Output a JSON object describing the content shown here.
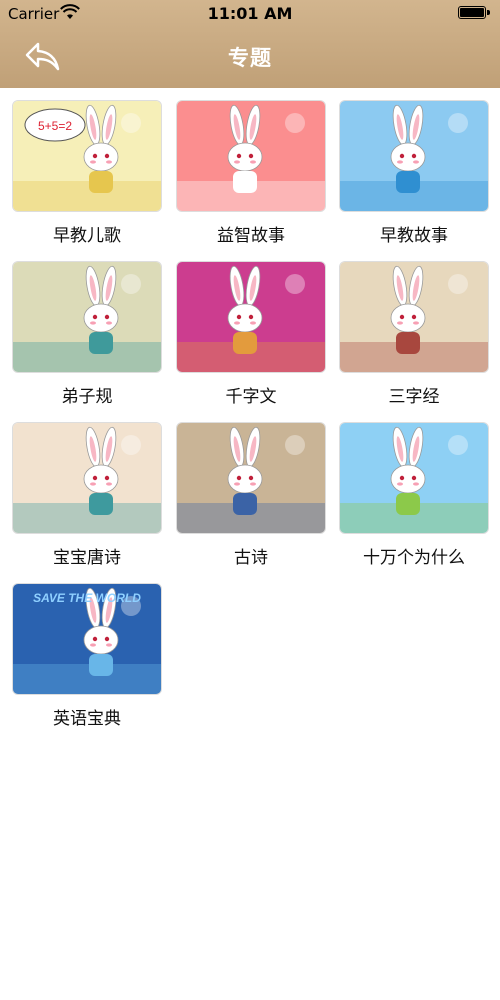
{
  "status_bar": {
    "carrier": "Carrier",
    "time": "11:01 AM",
    "battery_level": 1.0
  },
  "nav": {
    "title": "专题",
    "back_icon": "back-arrow-icon"
  },
  "colors": {
    "nav_bar": "#c9ac83",
    "nav_title": "#ffffff",
    "label_text": "#111111"
  },
  "topics": [
    {
      "label": "早教儿歌",
      "thumb_bg": "#f6efb8",
      "accent": "#e6c64e",
      "bubble_text": "5+5=2"
    },
    {
      "label": "益智故事",
      "thumb_bg": "#fb8e8f",
      "accent": "#ffffff"
    },
    {
      "label": "早教故事",
      "thumb_bg": "#8ccaf1",
      "accent": "#2f8fd1"
    },
    {
      "label": "弟子规",
      "thumb_bg": "#dcdbb8",
      "accent": "#3f9a9b"
    },
    {
      "label": "千字文",
      "thumb_bg": "#cc3d8f",
      "accent": "#e39b3d"
    },
    {
      "label": "三字经",
      "thumb_bg": "#e7d8bd",
      "accent": "#a8473e"
    },
    {
      "label": "宝宝唐诗",
      "thumb_bg": "#f2e2cf",
      "accent": "#3e9a9e"
    },
    {
      "label": "古诗",
      "thumb_bg": "#c9b496",
      "accent": "#3b63a6"
    },
    {
      "label": "十万个为什么",
      "thumb_bg": "#8ed0f4",
      "accent": "#8cc94a"
    },
    {
      "label": "英语宝典",
      "thumb_bg": "#2a62b0",
      "accent": "#68b6e8",
      "banner_text": "SAVE THE WORLD"
    }
  ]
}
